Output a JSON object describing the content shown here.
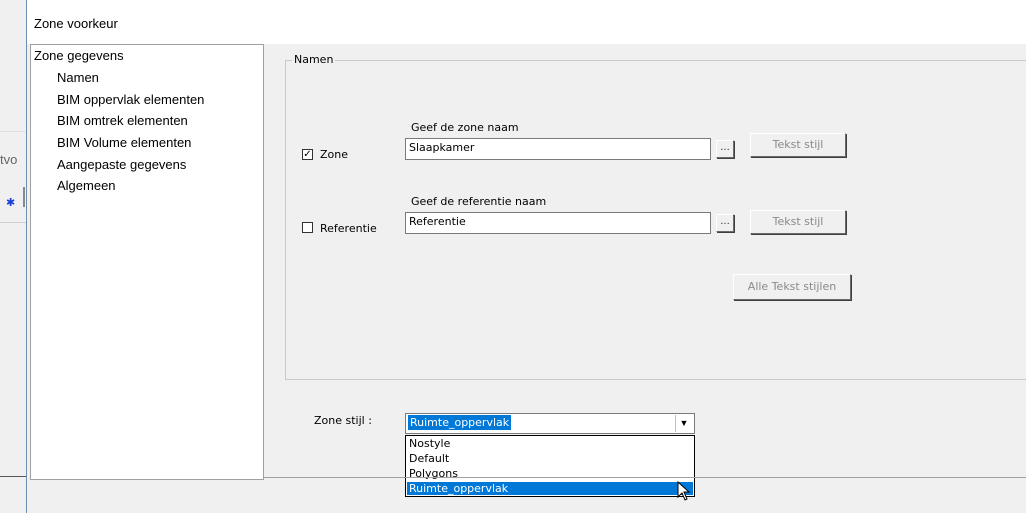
{
  "background_app": {
    "fragment_text": "tvo",
    "icon": "tool-icon"
  },
  "dialog": {
    "title": "Zone voorkeur"
  },
  "tree": {
    "root": "Zone gegevens",
    "items": [
      "Namen",
      "BIM oppervlak elementen",
      "BIM omtrek elementen",
      "BIM Volume elementen",
      "Aangepaste gegevens",
      "Algemeen"
    ]
  },
  "namen_group": {
    "label": "Namen",
    "zone": {
      "field_label": "Geef de zone naam",
      "checkbox_label": "Zone",
      "checked": true,
      "value": "Slaapkamer",
      "browse_label": "...",
      "style_button": "Tekst stijl"
    },
    "referentie": {
      "field_label": "Geef de referentie naam",
      "checkbox_label": "Referentie",
      "checked": false,
      "value": "Referentie",
      "browse_label": "...",
      "style_button": "Tekst stijl"
    },
    "all_styles_button": "Alle Tekst stijlen"
  },
  "zone_style": {
    "label": "Zone stijl :",
    "selected": "Ruimte_oppervlak",
    "options": [
      "Nostyle",
      "Default",
      "Polygons",
      "Ruimte_oppervlak"
    ]
  },
  "colors": {
    "selection": "#0078d7",
    "dialog_bg": "#f0f0f0",
    "disabled_text": "#8a8a8a"
  }
}
